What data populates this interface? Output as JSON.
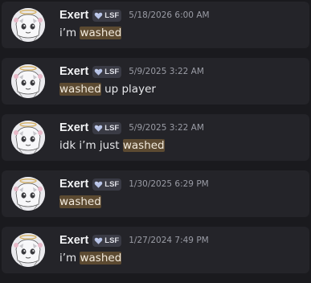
{
  "messages": [
    {
      "username": "Exert",
      "tag": "LSF",
      "timestamp": "5/18/2026 6:00 AM",
      "before": "i’m ",
      "highlight": "washed",
      "after": ""
    },
    {
      "username": "Exert",
      "tag": "LSF",
      "timestamp": "5/9/2025 3:22 AM",
      "before": "",
      "highlight": "washed",
      "after": " up player"
    },
    {
      "username": "Exert",
      "tag": "LSF",
      "timestamp": "5/9/2025 3:22 AM",
      "before": "idk i’m just ",
      "highlight": "washed",
      "after": ""
    },
    {
      "username": "Exert",
      "tag": "LSF",
      "timestamp": "1/30/2025 6:29 PM",
      "before": "",
      "highlight": "washed",
      "after": ""
    },
    {
      "username": "Exert",
      "tag": "LSF",
      "timestamp": "1/27/2024 7:49 PM",
      "before": "i’m ",
      "highlight": "washed",
      "after": ""
    }
  ],
  "colors": {
    "background": "#1a1a1e",
    "card": "#242429",
    "highlight": "#5c4a31",
    "tag_background": "#3a3b45"
  },
  "icons": {
    "avatar": "anime-character-avatar",
    "tag": "heart-badge-icon"
  }
}
